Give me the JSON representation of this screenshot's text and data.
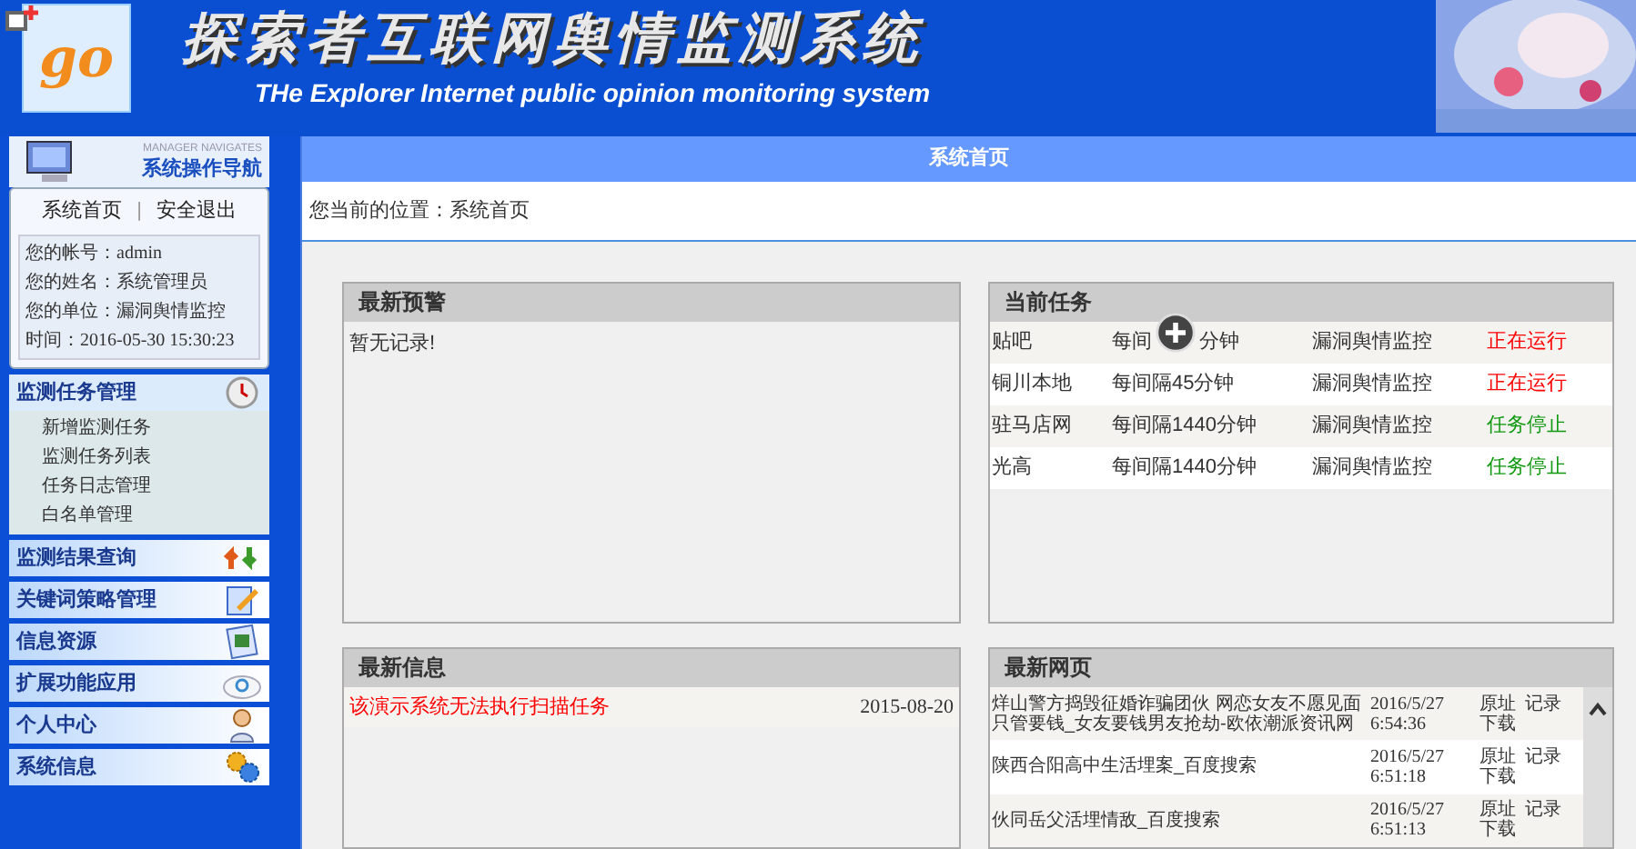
{
  "header": {
    "title": "探索者互联网舆情监测系统",
    "subtitle": "THe Explorer Internet public opinion monitoring system",
    "logo_text": "go"
  },
  "sidebar": {
    "caption": "MANAGER NAVIGATES",
    "title": "系统操作导航",
    "links": [
      "系统首页",
      "安全退出"
    ],
    "separator": "|",
    "info": [
      {
        "label": "您的帐号：",
        "value": "admin"
      },
      {
        "label": "您的姓名：",
        "value": "系统管理员"
      },
      {
        "label": "您的单位：",
        "value": "漏洞舆情监控"
      },
      {
        "label": "时间：",
        "value": "2016-05-30 15:30:23"
      }
    ],
    "menus": [
      {
        "label": "监测任务管理",
        "expanded": true,
        "children": [
          "新增监测任务",
          "监测任务列表",
          "任务日志管理",
          "白名单管理"
        ]
      },
      {
        "label": "监测结果查询",
        "expanded": false
      },
      {
        "label": "关键词策略管理",
        "expanded": false
      },
      {
        "label": "信息资源",
        "expanded": false
      },
      {
        "label": "扩展功能应用",
        "expanded": false
      },
      {
        "label": "个人中心",
        "expanded": false
      },
      {
        "label": "系统信息",
        "expanded": false
      }
    ]
  },
  "main": {
    "title": "系统首页",
    "breadcrumb": "您当前的位置：系统首页",
    "warnings": {
      "title": "最新预警",
      "empty": "暂无记录!"
    },
    "tasks": {
      "title": "当前任务",
      "rows": [
        {
          "name": "贴吧",
          "interval": "每间",
          "interval_tail": "分钟",
          "unit": "漏洞舆情监控",
          "status": "正在运行",
          "running": true
        },
        {
          "name": "铜川本地",
          "interval": "每间隔45分钟",
          "unit": "漏洞舆情监控",
          "status": "正在运行",
          "running": true
        },
        {
          "name": "驻马店网",
          "interval": "每间隔1440分钟",
          "unit": "漏洞舆情监控",
          "status": "任务停止",
          "running": false
        },
        {
          "name": "光高",
          "interval": "每间隔1440分钟",
          "unit": "漏洞舆情监控",
          "status": "任务停止",
          "running": false
        }
      ]
    },
    "news": {
      "title": "最新信息",
      "rows": [
        {
          "text": "该演示系统无法执行扫描任务",
          "date": "2015-08-20"
        }
      ]
    },
    "pages": {
      "title": "最新网页",
      "rows": [
        {
          "title": "烊山警方捣毁征婚诈骗团伙 网恋女友不愿见面只管要钱_女友要钱男友抢劫-欧依潮派资讯网",
          "date": "2016/5/27",
          "time": "6:54:36",
          "link1": "原址",
          "link2": "记录",
          "link3": "下载"
        },
        {
          "title": "陕西合阳高中生活埋案_百度搜索",
          "date": "2016/5/27",
          "time": "6:51:18",
          "link1": "原址",
          "link2": "记录",
          "link3": "下载"
        },
        {
          "title": "伙同岳父活埋情敌_百度搜索",
          "date": "2016/5/27",
          "time": "6:51:13",
          "link1": "原址",
          "link2": "记录",
          "link3": "下载"
        }
      ]
    }
  }
}
